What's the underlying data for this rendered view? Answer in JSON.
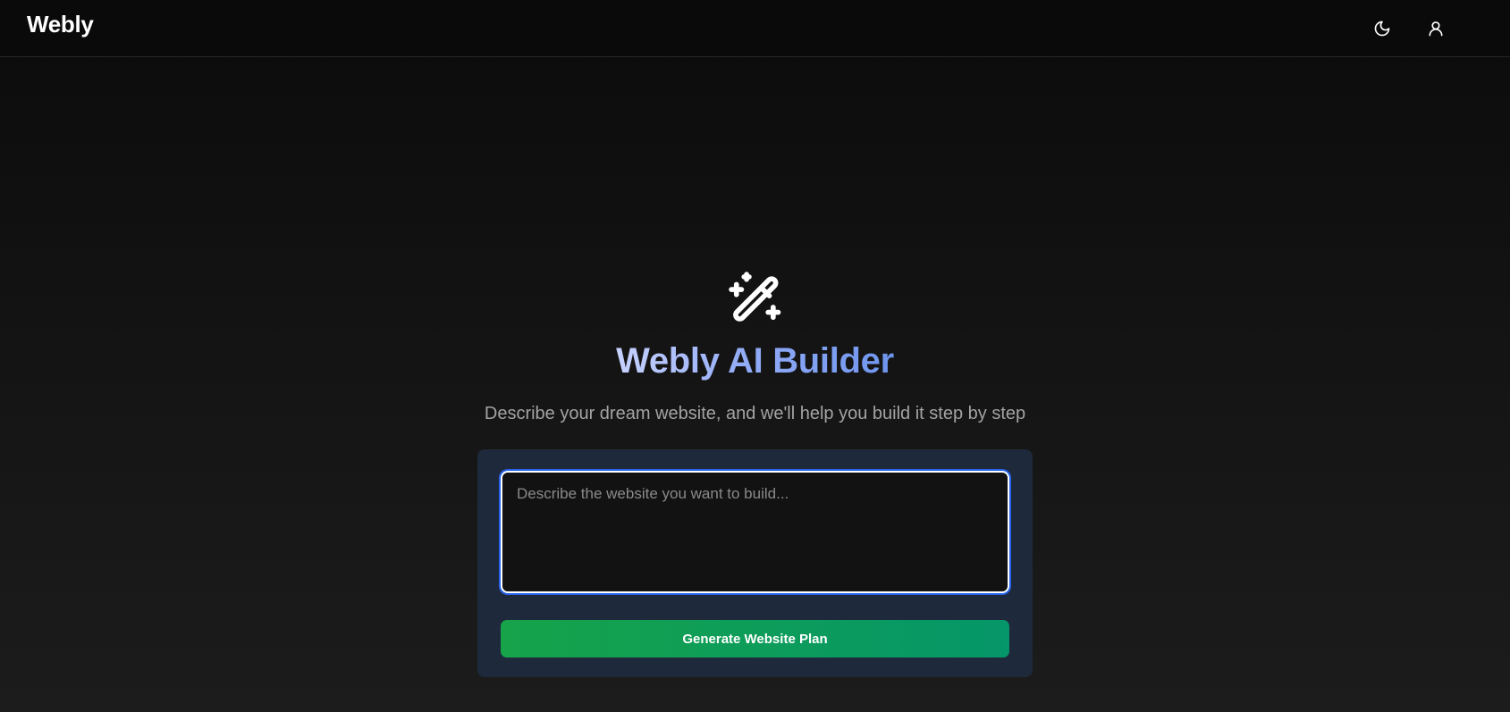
{
  "header": {
    "logo": "Webly",
    "theme_toggle_icon": "moon-icon",
    "account_icon": "user-icon"
  },
  "hero": {
    "icon": "magic-wand-icon",
    "title": "Webly AI Builder",
    "subtitle": "Describe your dream website, and we'll help you build it step by step"
  },
  "form": {
    "prompt_value": "",
    "prompt_placeholder": "Describe the website you want to build...",
    "submit_label": "Generate Website Plan"
  },
  "colors": {
    "accent_green": "#16a34a",
    "accent_teal": "#059669",
    "title_gradient_start": "#c7d2fe",
    "title_gradient_end": "#6e95ee",
    "card_background": "#1e293b",
    "focus_ring": "#2563eb"
  }
}
